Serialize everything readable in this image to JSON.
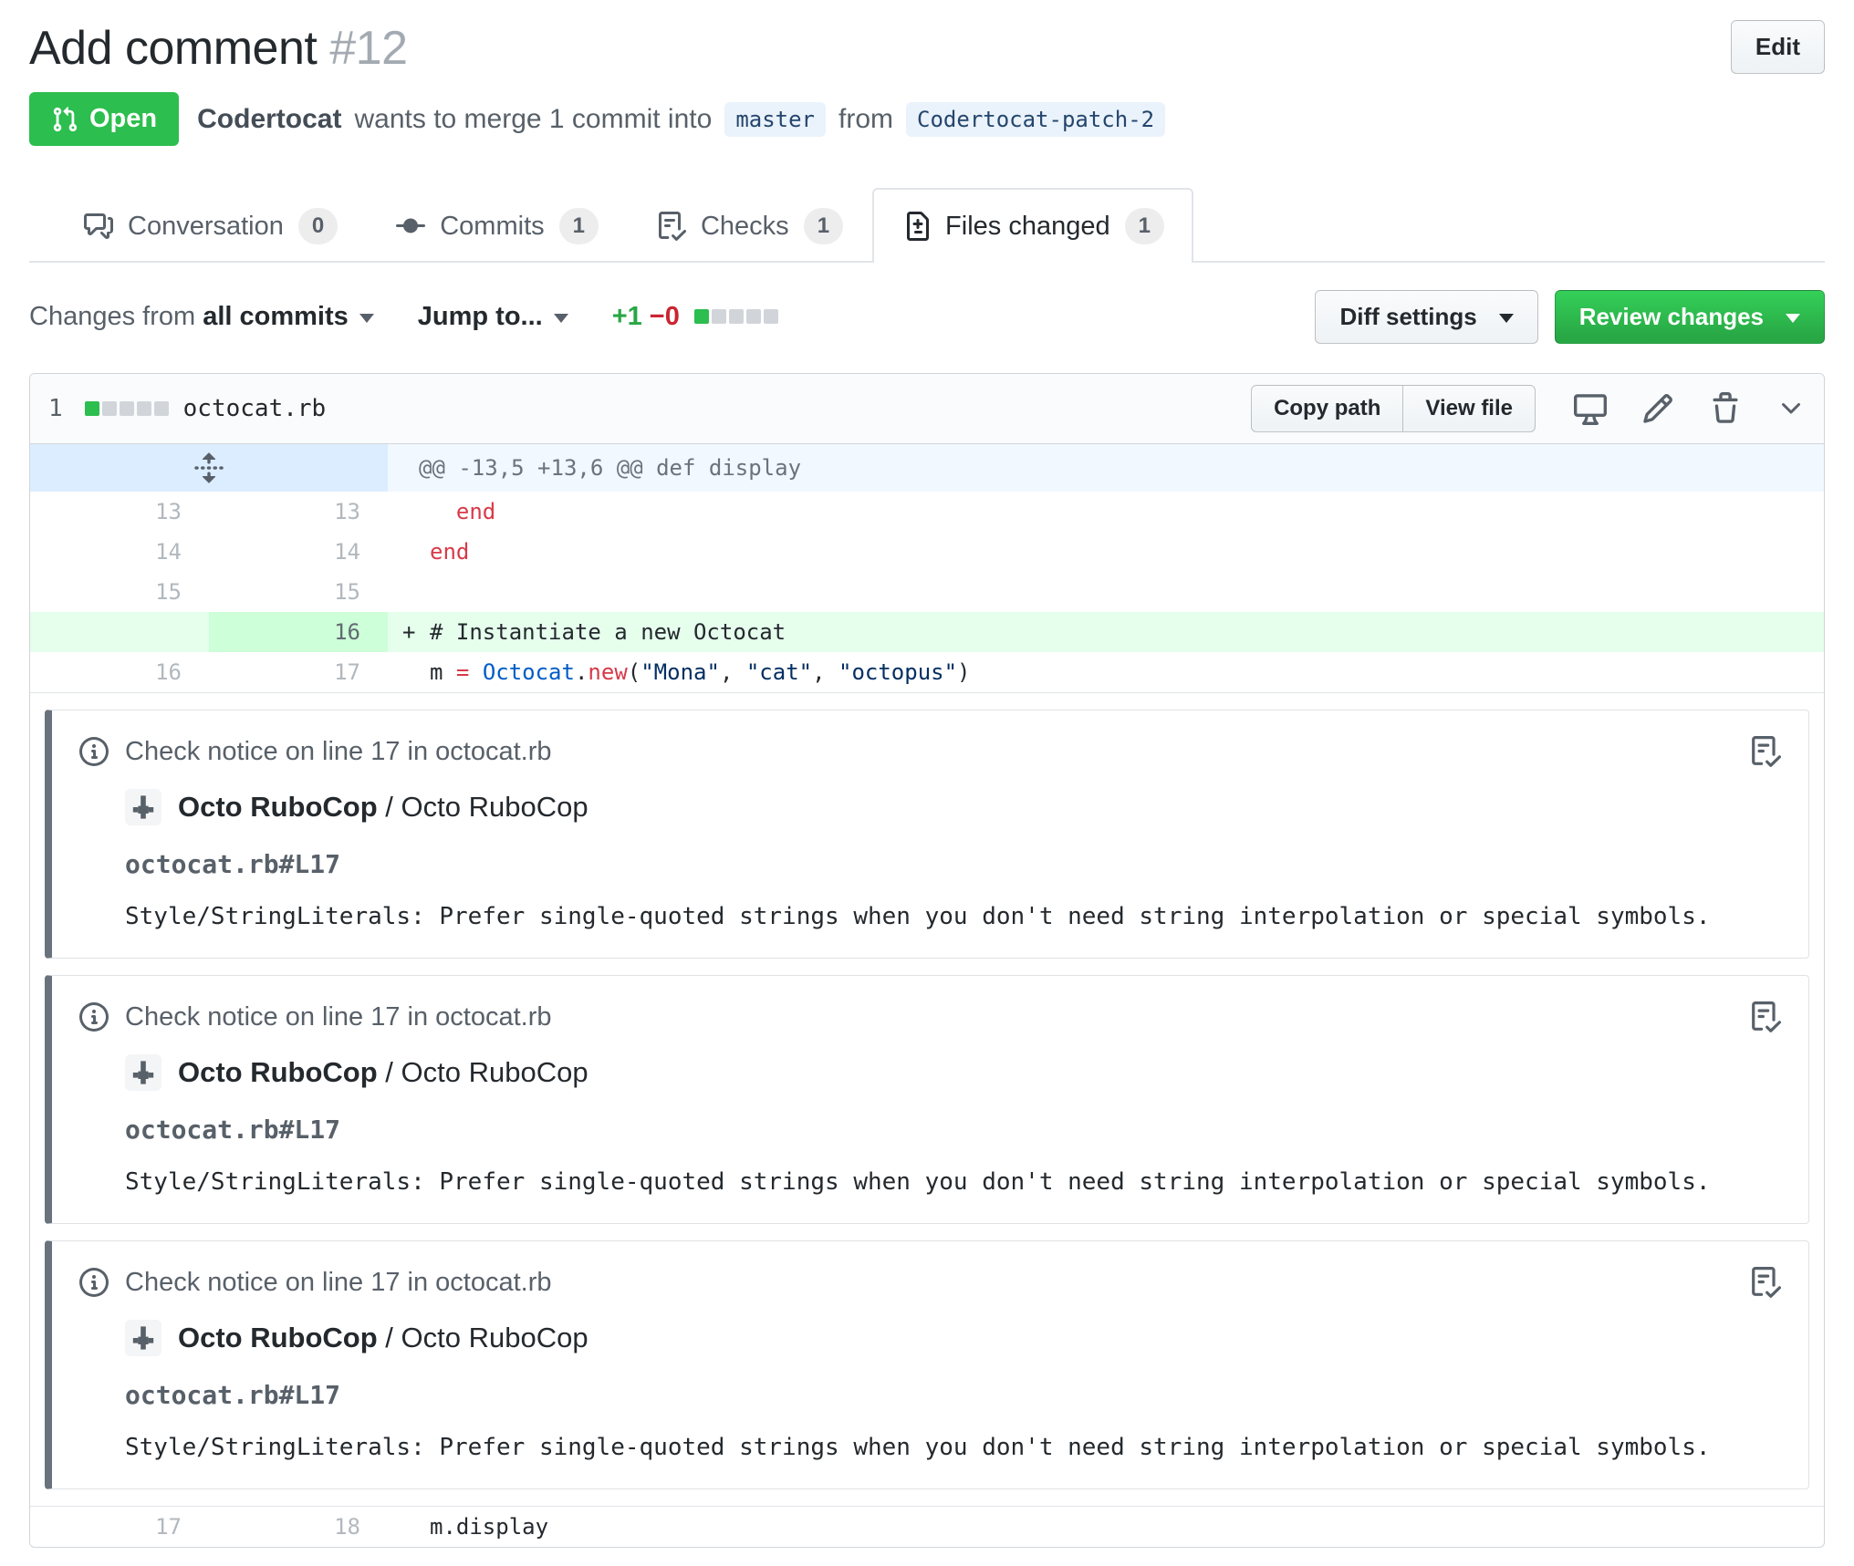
{
  "header": {
    "title": "Add comment",
    "number": "#12",
    "edit_button": "Edit"
  },
  "pr_meta": {
    "state_label": "Open",
    "author": "Codertocat",
    "action_text": "wants to merge 1 commit into",
    "base_branch": "master",
    "from_text": "from",
    "head_branch": "Codertocat-patch-2"
  },
  "tabs": [
    {
      "label": "Conversation",
      "count": "0"
    },
    {
      "label": "Commits",
      "count": "1"
    },
    {
      "label": "Checks",
      "count": "1"
    },
    {
      "label": "Files changed",
      "count": "1"
    }
  ],
  "toolbar": {
    "changes_from_label": "Changes from ",
    "changes_from_value": "all commits",
    "jump_to_label": "Jump to...",
    "additions": "+1",
    "deletions": "−0",
    "diff_settings_button": "Diff settings",
    "review_changes_button": "Review changes"
  },
  "file_header": {
    "changed_files_count": "1",
    "filename": "octocat.rb",
    "copy_path_button": "Copy path",
    "view_file_button": "View file"
  },
  "diff": {
    "hunk_header": "@@ -13,5 +13,6 @@ def display",
    "rows": [
      {
        "old": "13",
        "new": "13",
        "marker": "",
        "tokens": [
          {
            "t": "  "
          },
          {
            "t": "end",
            "c": "k"
          }
        ]
      },
      {
        "old": "14",
        "new": "14",
        "marker": "",
        "tokens": [
          {
            "t": "end",
            "c": "k"
          }
        ]
      },
      {
        "old": "15",
        "new": "15",
        "marker": "",
        "tokens": []
      },
      {
        "old": "",
        "new": "16",
        "marker": "+",
        "tokens": [
          {
            "t": "# Instantiate a new Octocat"
          }
        ]
      },
      {
        "old": "16",
        "new": "17",
        "marker": "",
        "tokens": [
          {
            "t": "m "
          },
          {
            "t": "=",
            "c": "k"
          },
          {
            "t": " "
          },
          {
            "t": "Octocat",
            "c": "c"
          },
          {
            "t": "."
          },
          {
            "t": "new",
            "c": "k"
          },
          {
            "t": "("
          },
          {
            "t": "\"Mona\"",
            "c": "s"
          },
          {
            "t": ", "
          },
          {
            "t": "\"cat\"",
            "c": "s"
          },
          {
            "t": ", "
          },
          {
            "t": "\"octopus\"",
            "c": "s"
          },
          {
            "t": ")"
          }
        ]
      },
      {
        "old": "17",
        "new": "18",
        "marker": "",
        "tokens": [
          {
            "t": "m.display"
          }
        ]
      }
    ]
  },
  "notices": [
    {
      "header": "Check notice on line 17 in octocat.rb",
      "app_name": "Octo RuboCop",
      "separator": " / ",
      "run_name": "Octo RuboCop",
      "file_ref": "octocat.rb#L17",
      "message": "Style/StringLiterals: Prefer single-quoted strings when you don't need string interpolation or special symbols."
    },
    {
      "header": "Check notice on line 17 in octocat.rb",
      "app_name": "Octo RuboCop",
      "separator": " / ",
      "run_name": "Octo RuboCop",
      "file_ref": "octocat.rb#L17",
      "message": "Style/StringLiterals: Prefer single-quoted strings when you don't need string interpolation or special symbols."
    },
    {
      "header": "Check notice on line 17 in octocat.rb",
      "app_name": "Octo RuboCop",
      "separator": " / ",
      "run_name": "Octo RuboCop",
      "file_ref": "octocat.rb#L17",
      "message": "Style/StringLiterals: Prefer single-quoted strings when you don't need string interpolation or special symbols."
    }
  ],
  "colors": {
    "state_open_bg": "#2cbe4e",
    "added_line_bg": "#e6ffed",
    "added_gutter_bg": "#cdffd8",
    "hunk_code_bg": "#f1f8ff",
    "hunk_gutter_bg": "#dbedff",
    "additions_text": "#28a745",
    "deletions_text": "#cb2431",
    "branch_label_bg": "#eaf2fb",
    "branch_label_text": "#24466d",
    "notice_left_bar": "#6a737d",
    "keyword_token": "#d73a49",
    "constant_token": "#005cc5",
    "string_token": "#032f62"
  },
  "icons": [
    "git-pull-request-icon",
    "comment-discussion-icon",
    "git-commit-icon",
    "checklist-icon",
    "file-diff-icon",
    "dropdown-caret-icon",
    "unfold-icon",
    "device-desktop-icon",
    "pencil-icon",
    "trash-icon",
    "chevron-down-icon",
    "info-icon",
    "identicon-avatar",
    "checks-icon"
  ]
}
